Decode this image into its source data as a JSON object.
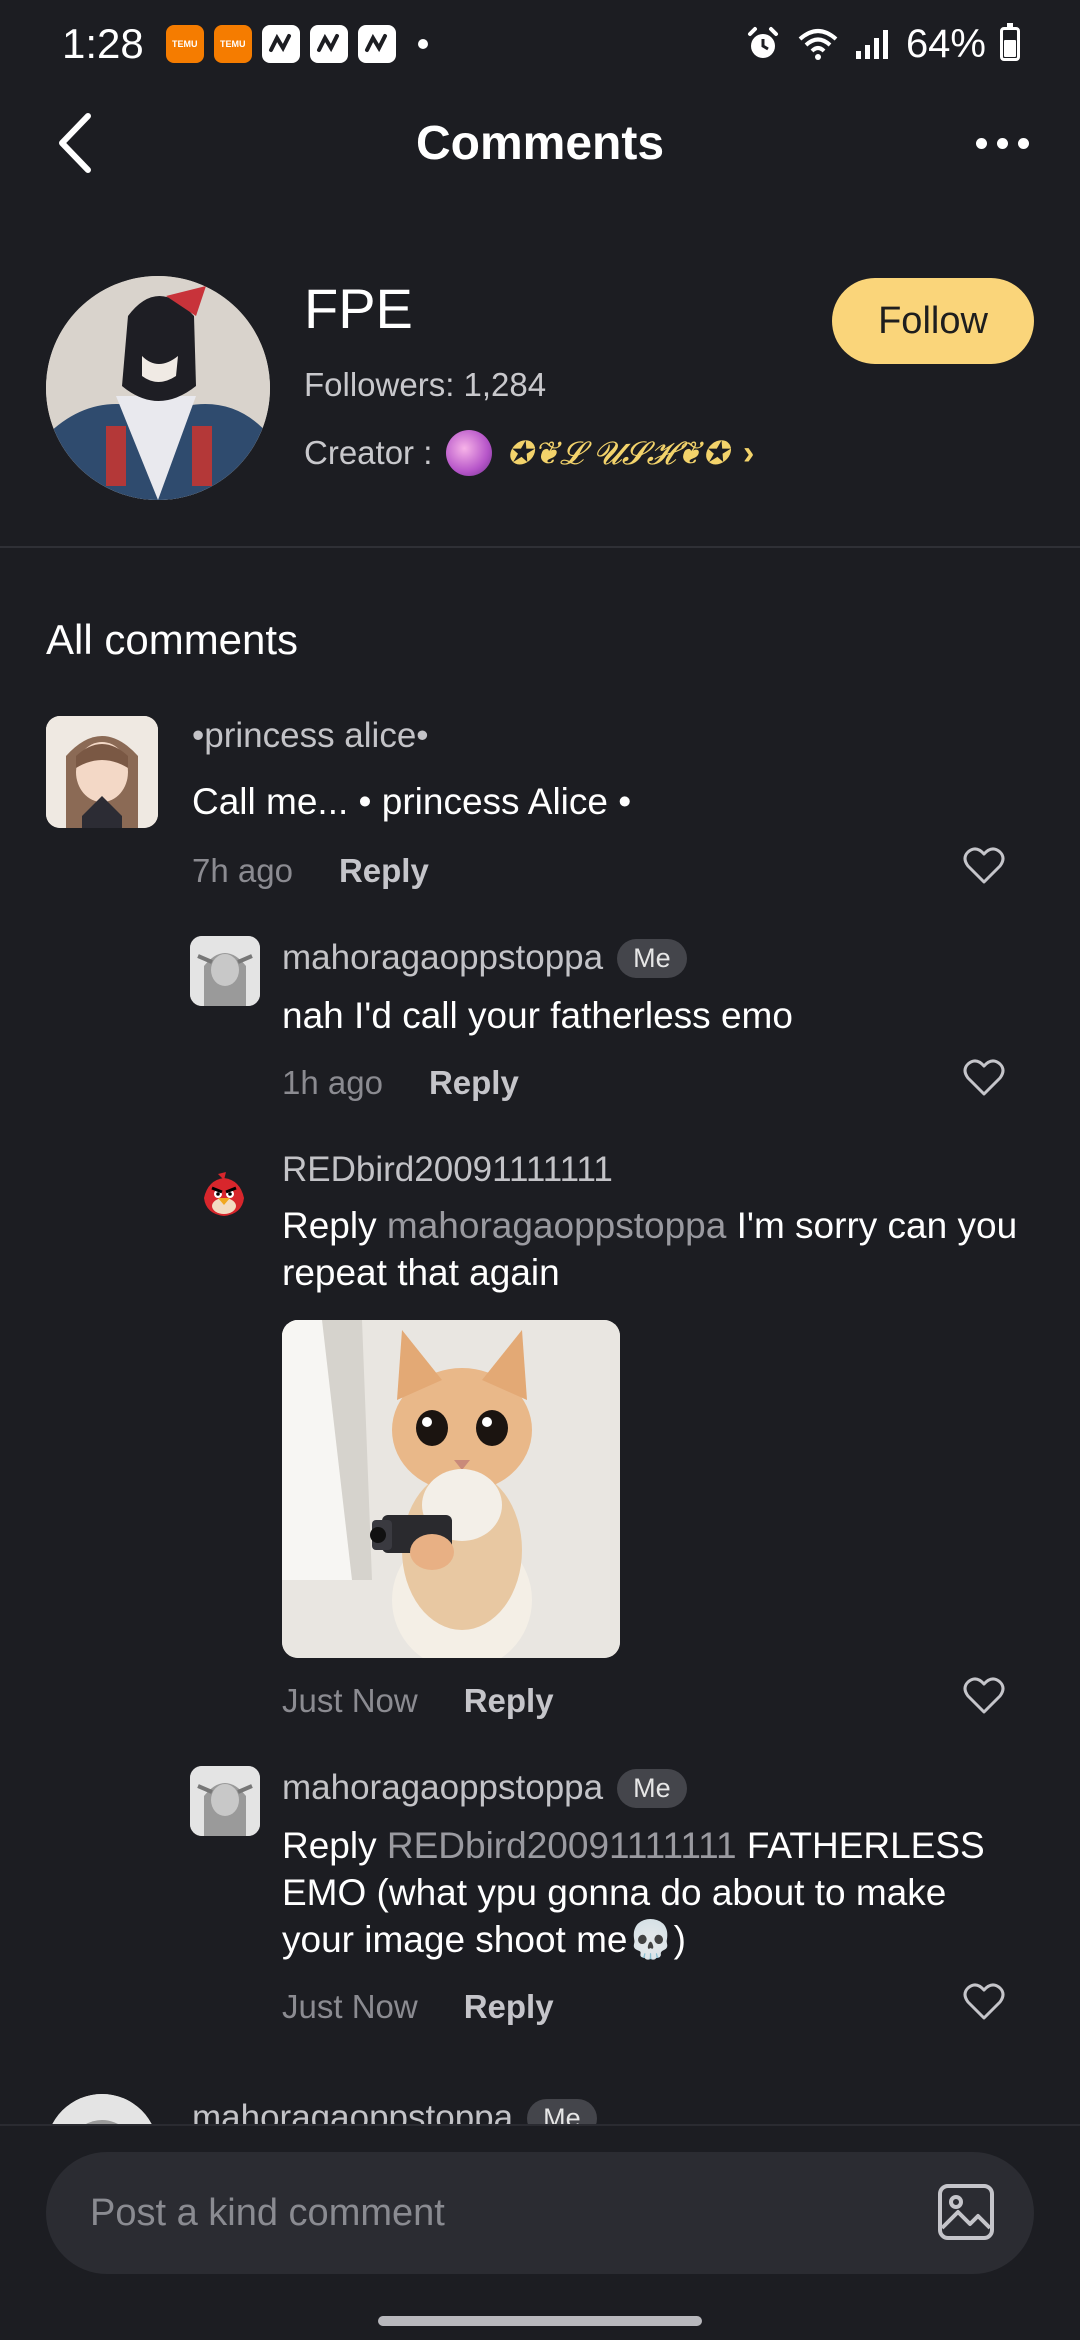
{
  "status_bar": {
    "time": "1:28",
    "battery": "64%",
    "temu_label": "TEMU"
  },
  "header": {
    "title": "Comments"
  },
  "profile": {
    "name": "FPE",
    "followers": "Followers: 1,284",
    "creator_label": "Creator :",
    "creator_name": "✪❦𝓛 𝓤𝓢𝓗❦✪",
    "follow_label": "Follow"
  },
  "comments_section": {
    "title": "All comments"
  },
  "comments": [
    {
      "user": "•princess alice•",
      "text": "Call me... • princess Alice •",
      "time": "7h ago",
      "reply_label": "Reply"
    },
    {
      "user": "mahoragaoppstoppa",
      "badge": "Me",
      "text": "nah I'd call your fatherless emo",
      "time": "1h ago",
      "reply_label": "Reply"
    },
    {
      "user": "REDbird20091111111",
      "reply_prefix": "Reply",
      "mention": "mahoragaoppstoppa",
      "text": "I'm sorry can you repeat that again",
      "time": "Just Now",
      "reply_label": "Reply"
    },
    {
      "user": "mahoragaoppstoppa",
      "badge": "Me",
      "reply_prefix": "Reply",
      "mention": "REDbird20091111111",
      "text": "FATHERLESS EMO (what ypu gonna do about to make your image shoot me💀)",
      "time": "Just Now",
      "reply_label": "Reply"
    },
    {
      "user": "mahoragaoppstoppa",
      "badge": "Me"
    }
  ],
  "composer": {
    "placeholder": "Post a kind comment"
  },
  "colors": {
    "background": "#1c1d22",
    "follow_button": "#fad57a",
    "creator_name": "#f3d36b",
    "muted_text": "#8b8b91",
    "badge": "#44454b"
  },
  "icons": {
    "back": "chevron-left-icon",
    "more": "more-dots-icon",
    "like": "heart-icon",
    "image": "image-icon",
    "alarm": "alarm-icon",
    "wifi": "wifi-icon",
    "signal": "signal-icon",
    "battery": "battery-icon"
  }
}
